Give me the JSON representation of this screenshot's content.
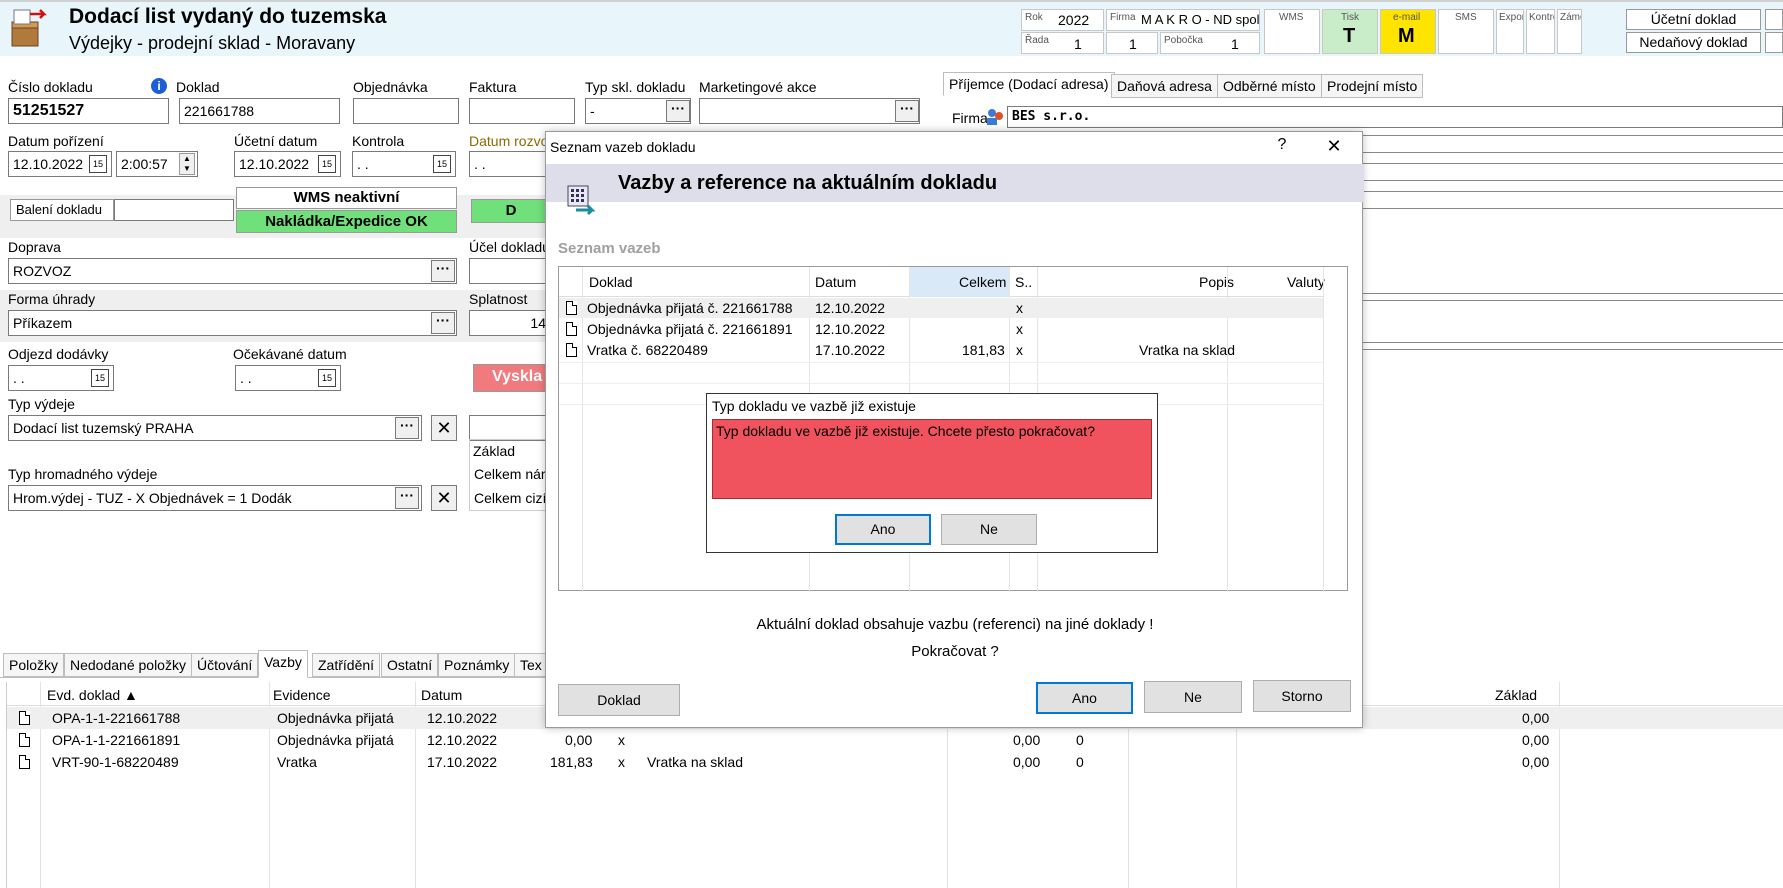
{
  "header": {
    "title": "Dodací list vydaný do tuzemska",
    "subtitle": "Výdejky - prodejní sklad - Moravany",
    "rok_label": "Rok",
    "rok_value": "2022",
    "firma_label": "Firma",
    "firma_value": "M A K R O - ND spol",
    "rada_label": "Řada",
    "rada_value": "1",
    "rada2_value": "1",
    "pobocka_label": "Pobočka",
    "pobocka_value": "1",
    "wms_label": "WMS",
    "tisk_label": "Tisk",
    "tisk_value": "T",
    "email_label": "e-mail",
    "email_value": "M",
    "sms_label": "SMS",
    "export_label": "Export",
    "kontrola_label": "Kontrola",
    "zamek_label": "Zámek",
    "ucetni_doklad": "Účetní doklad",
    "nedanovy_doklad": "Nedaňový doklad"
  },
  "form": {
    "cislo_dokladu_label": "Číslo dokladu",
    "cislo_dokladu": "51251527",
    "doklad_label": "Doklad",
    "doklad": "221661788",
    "objednavka_label": "Objednávka",
    "faktura_label": "Faktura",
    "typ_skl_label": "Typ skl. dokladu",
    "typ_skl_value": "-",
    "marketing_label": "Marketingové akce",
    "datum_porizeni_label": "Datum pořízení",
    "datum_porizeni": "12.10.2022",
    "cas": "2:00:57",
    "ucetni_datum_label": "Účetní datum",
    "ucetni_datum": "12.10.2022",
    "kontrola_label": "Kontrola",
    "kontrola_value": ". .",
    "datum_rozvozu_label": "Datum rozvo",
    "datum_rozvozu_value": ". .",
    "baleni_label": "Balení dokladu",
    "wms_status": "WMS neaktivní",
    "nakladka_status": "Nakládka/Expedice OK",
    "green2_text": "D",
    "doprava_label": "Doprava",
    "doprava": "ROZVOZ",
    "ucel_label": "Účel dokladu",
    "forma_label": "Forma úhrady",
    "forma": "Příkazem",
    "splatnost_label": "Splatnost",
    "splatnost": "14",
    "odjezd_label": "Odjezd dodávky",
    "odjezd": ". .",
    "ocekavane_label": "Očekávané datum",
    "ocekavane": ". .",
    "vyskl_text": "Vyskla",
    "typ_vydeje_label": "Typ výdeje",
    "typ_vydeje": "Dodací list tuzemský PRAHA",
    "typ_hrom_label": "Typ hromadného výdeje",
    "typ_hrom": "Hrom.výdej - TUZ - X Objednávek = 1 Dodák",
    "zaklad_label": "Základ",
    "celkem_nar_label": "Celkem nár",
    "celkem_ciz_label": "Celkem cizí"
  },
  "right_tabs": [
    "Příjemce (Dodací adresa)",
    "Daňová adresa",
    "Odběrné místo",
    "Prodejní místo"
  ],
  "firma_field_label": "Firma",
  "firma_field_value": "BES s.r.o.",
  "bottom_tabs": [
    "Položky",
    "Nedodané položky",
    "Účtování",
    "Vazby",
    "Zatřídění",
    "Ostatní",
    "Poznámky",
    "Tex"
  ],
  "bottom_grid": {
    "headers": [
      "Evd. doklad ▲",
      "Evidence",
      "Datum",
      "Základ"
    ],
    "rows": [
      {
        "evd": "OPA-1-1-221661788",
        "evidence": "Objednávka přijatá",
        "datum": "12.10.2022",
        "celkem": "",
        "s": "",
        "popis": "",
        "c1": "",
        "c2": "",
        "zaklad": "0,00"
      },
      {
        "evd": "OPA-1-1-221661891",
        "evidence": "Objednávka přijatá",
        "datum": "12.10.2022",
        "celkem": "0,00",
        "s": "x",
        "popis": "",
        "c1": "0,00",
        "c2": "0",
        "zaklad": "0,00"
      },
      {
        "evd": "VRT-90-1-68220489",
        "evidence": "Vratka",
        "datum": "17.10.2022",
        "celkem": "181,83",
        "s": "x",
        "popis": "Vratka na sklad",
        "c1": "0,00",
        "c2": "0",
        "zaklad": "0,00"
      }
    ]
  },
  "dialog": {
    "title": "Seznam vazeb dokladu",
    "help": "?",
    "close": "✕",
    "heading": "Vazby a reference na aktuálním dokladu",
    "section": "Seznam vazeb",
    "headers": [
      "Doklad",
      "Datum",
      "Celkem",
      "S..",
      "Popis",
      "Valuty"
    ],
    "rows": [
      {
        "doklad": "Objednávka přijatá č. 221661788",
        "datum": "12.10.2022",
        "celkem": "",
        "s": "x",
        "popis": ""
      },
      {
        "doklad": "Objednávka přijatá č. 221661891",
        "datum": "12.10.2022",
        "celkem": "",
        "s": "x",
        "popis": ""
      },
      {
        "doklad": "Vratka č. 68220489",
        "datum": "17.10.2022",
        "celkem": "181,83",
        "s": "x",
        "popis": "Vratka na sklad"
      }
    ],
    "info1": "Aktuální doklad obsahuje vazbu (referenci) na jiné doklady !",
    "info2": "Pokračovat ?",
    "btn_doklad": "Doklad",
    "btn_ano": "Ano",
    "btn_ne": "Ne",
    "btn_storno": "Storno"
  },
  "confirm": {
    "title": "Typ dokladu ve vazbě již existuje",
    "message": "Typ dokladu ve vazbě již existuje. Chcete přesto pokračovat?",
    "btn_ano": "Ano",
    "btn_ne": "Ne",
    "message_bg": "#f0535e"
  },
  "colors": {
    "title_bg": "#e8f5fb",
    "green": "#6fe07a",
    "red_btn": "#f07a7e",
    "yellow": "#ffe400",
    "lightgreen": "#c8edc8",
    "dialog_band": "#dedeeb",
    "accent": "#0078d7"
  }
}
